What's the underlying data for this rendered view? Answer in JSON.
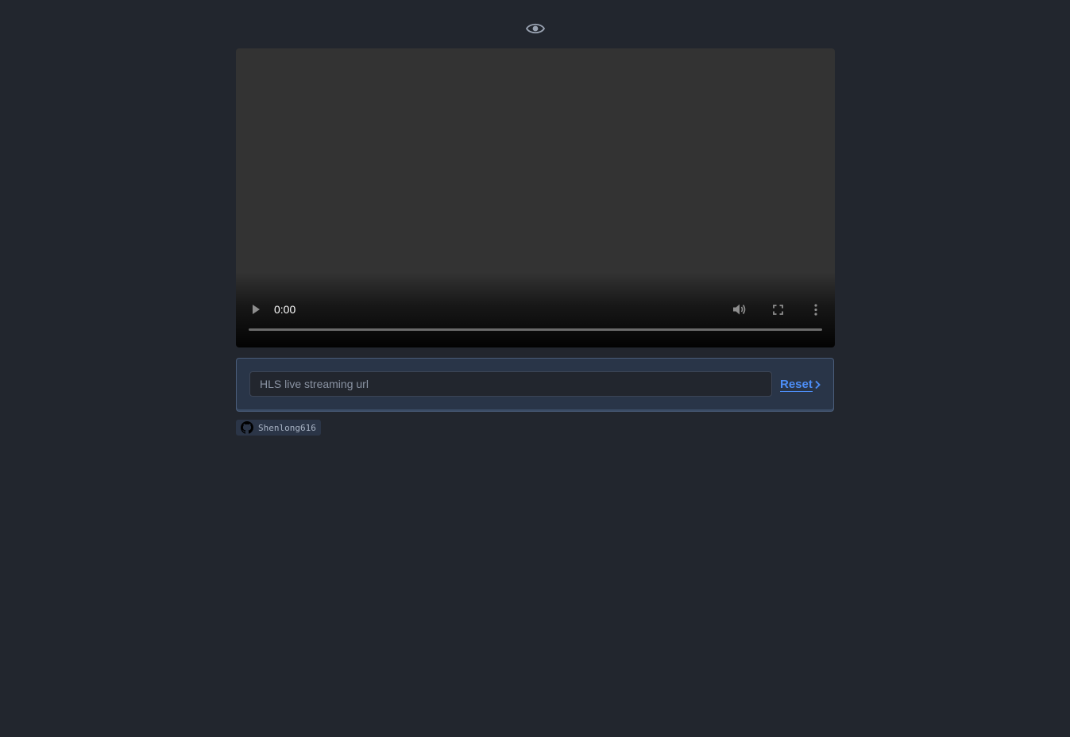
{
  "header": {
    "logo_icon": "eye-icon"
  },
  "player": {
    "time": "0:00",
    "progress": 0,
    "controls": {
      "play_icon": "play-icon",
      "volume_icon": "volume-icon",
      "fullscreen_icon": "fullscreen-icon",
      "more_icon": "more-vertical-icon"
    }
  },
  "url_form": {
    "input_value": "",
    "input_placeholder": "HLS live streaming url",
    "reset_label": "Reset",
    "reset_icon": "chevron-right-icon"
  },
  "footer": {
    "github_icon": "github-icon",
    "github_user": "Shenlong616"
  },
  "colors": {
    "background": "#22262e",
    "accent": "#4d8ef7",
    "panel": "#293548",
    "player": "#333333"
  }
}
